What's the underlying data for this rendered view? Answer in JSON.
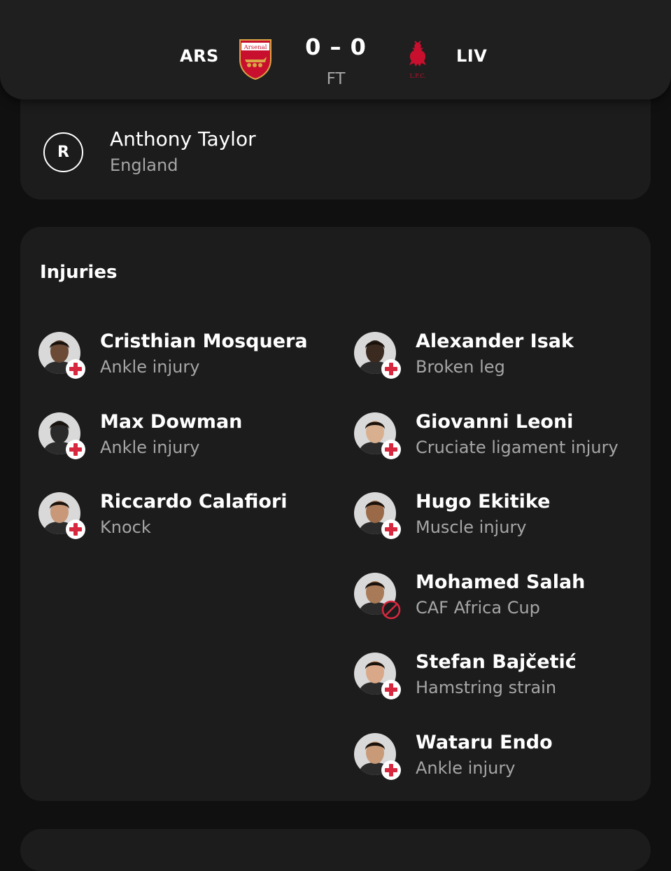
{
  "match": {
    "home_code": "ARS",
    "away_code": "LIV",
    "score": "0 – 0",
    "status": "FT",
    "home_crest_text": "Arsenal",
    "away_crest_text": "L.F.C."
  },
  "referee": {
    "badge": "R",
    "name": "Anthony Taylor",
    "country": "England"
  },
  "injuries": {
    "title": "Injuries",
    "home": [
      {
        "name": "Cristhian Mosquera",
        "reason": "Ankle injury",
        "status_icon": "injury-cross-icon"
      },
      {
        "name": "Max Dowman",
        "reason": "Ankle injury",
        "status_icon": "injury-cross-icon"
      },
      {
        "name": "Riccardo Calafiori",
        "reason": "Knock",
        "status_icon": "injury-cross-icon"
      }
    ],
    "away": [
      {
        "name": "Alexander Isak",
        "reason": "Broken leg",
        "status_icon": "injury-cross-icon"
      },
      {
        "name": "Giovanni Leoni",
        "reason": "Cruciate ligament injury",
        "status_icon": "injury-cross-icon"
      },
      {
        "name": "Hugo Ekitike",
        "reason": "Muscle injury",
        "status_icon": "injury-cross-icon"
      },
      {
        "name": "Mohamed Salah",
        "reason": "CAF Africa Cup",
        "status_icon": "unavailable-icon"
      },
      {
        "name": "Stefan Bajčetić",
        "reason": "Hamstring strain",
        "status_icon": "injury-cross-icon"
      },
      {
        "name": "Wataru Endo",
        "reason": "Ankle injury",
        "status_icon": "injury-cross-icon"
      }
    ]
  },
  "colors": {
    "background": "#101010",
    "card": "#1c1c1c",
    "secondary_text": "#a6a6a6",
    "injury_red": "#d8283f"
  }
}
